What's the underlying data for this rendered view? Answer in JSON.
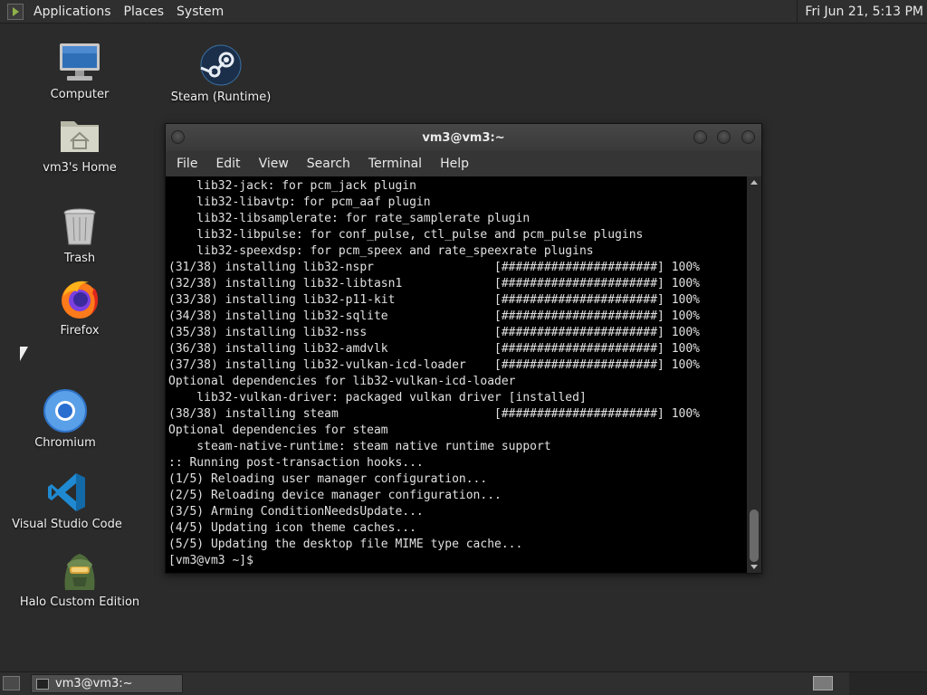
{
  "top_panel": {
    "menus": [
      "Applications",
      "Places",
      "System"
    ],
    "clock": "Fri Jun 21,  5:13 PM"
  },
  "desktop_icons": [
    {
      "label": "Computer",
      "icon": "computer-icon"
    },
    {
      "label": "Steam (Runtime)",
      "icon": "steam-icon"
    },
    {
      "label": "vm3's Home",
      "icon": "home-folder-icon"
    },
    {
      "label": "Trash",
      "icon": "trash-icon"
    },
    {
      "label": "Firefox",
      "icon": "firefox-icon"
    },
    {
      "label": "Chromium",
      "icon": "chromium-icon"
    },
    {
      "label": "Visual Studio Code",
      "icon": "vscode-icon"
    },
    {
      "label": "Halo Custom Edition",
      "icon": "halo-icon"
    }
  ],
  "terminal": {
    "title": "vm3@vm3:~",
    "menu": [
      "File",
      "Edit",
      "View",
      "Search",
      "Terminal",
      "Help"
    ],
    "lines": [
      "    lib32-jack: for pcm_jack plugin",
      "    lib32-libavtp: for pcm_aaf plugin",
      "    lib32-libsamplerate: for rate_samplerate plugin",
      "    lib32-libpulse: for conf_pulse, ctl_pulse and pcm_pulse plugins",
      "    lib32-speexdsp: for pcm_speex and rate_speexrate plugins",
      "(31/38) installing lib32-nspr                 [######################] 100%",
      "(32/38) installing lib32-libtasn1             [######################] 100%",
      "(33/38) installing lib32-p11-kit              [######################] 100%",
      "(34/38) installing lib32-sqlite               [######################] 100%",
      "(35/38) installing lib32-nss                  [######################] 100%",
      "(36/38) installing lib32-amdvlk               [######################] 100%",
      "(37/38) installing lib32-vulkan-icd-loader    [######################] 100%",
      "Optional dependencies for lib32-vulkan-icd-loader",
      "    lib32-vulkan-driver: packaged vulkan driver [installed]",
      "(38/38) installing steam                      [######################] 100%",
      "Optional dependencies for steam",
      "    steam-native-runtime: steam native runtime support",
      ":: Running post-transaction hooks...",
      "(1/5) Reloading user manager configuration...",
      "(2/5) Reloading device manager configuration...",
      "(3/5) Arming ConditionNeedsUpdate...",
      "(4/5) Updating icon theme caches...",
      "(5/5) Updating the desktop file MIME type cache...",
      "[vm3@vm3 ~]$ "
    ]
  },
  "taskbar": {
    "window_label": "vm3@vm3:~"
  },
  "colors": {
    "desktop": "#2b2b2b",
    "panel": "#2f2f2f",
    "terminal_bg": "#000000",
    "terminal_fg": "#e0e0e0"
  }
}
